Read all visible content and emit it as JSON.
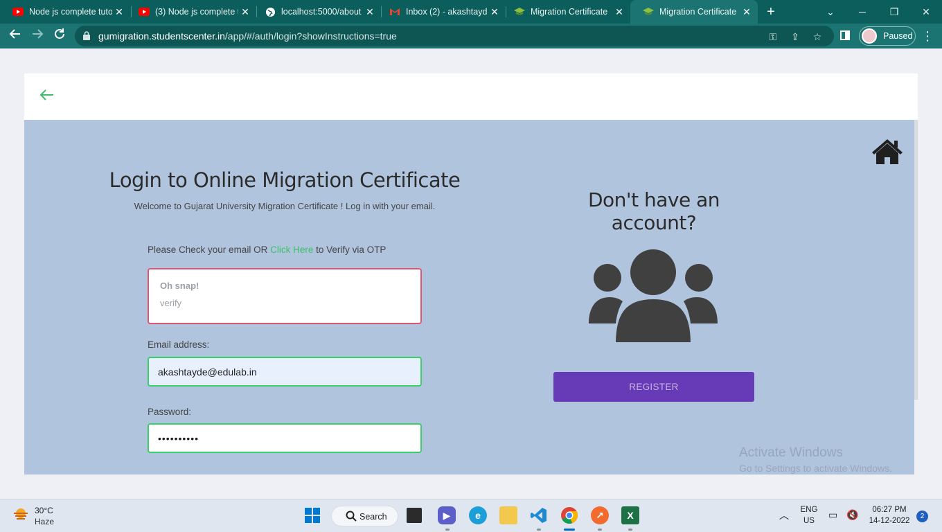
{
  "browser": {
    "tabs": [
      {
        "label": "Node js complete tuto",
        "icon": "youtube-icon"
      },
      {
        "label": "(3) Node js complete t",
        "icon": "youtube-icon"
      },
      {
        "label": "localhost:5000/about",
        "icon": "globe-icon"
      },
      {
        "label": "Inbox (2) - akashtayde",
        "icon": "gmail-icon"
      },
      {
        "label": "Migration Certificate",
        "icon": "graduation-cap-icon"
      },
      {
        "label": "Migration Certificate",
        "icon": "graduation-cap-icon"
      }
    ],
    "active_tab": 5,
    "url_host": "gumigration.studentscenter.in",
    "url_path": "/app/#/auth/login?showInstructions=true",
    "profile_label": "Paused"
  },
  "login": {
    "title": "Login to Online Migration Certificate",
    "subtitle": "Welcome to Gujarat University Migration Certificate ! Log in with your email.",
    "check_prefix": "Please Check your email OR ",
    "check_link": "Click Here",
    "check_suffix": " to Verify via OTP",
    "alert_title": "Oh snap!",
    "alert_message": "verify",
    "email_label": "Email address:",
    "email_value": "akashtayde@edulab.in",
    "password_label": "Password:",
    "password_value": "••••••••••"
  },
  "register": {
    "title": "Don't have an account?",
    "button_label": "REGISTER"
  },
  "watermark": {
    "line1": "Activate Windows",
    "line2": "Go to Settings to activate Windows."
  },
  "taskbar": {
    "temperature": "30°C",
    "weather": "Haze",
    "search_label": "Search",
    "lang": "ENG",
    "region": "US",
    "time": "06:27 PM",
    "date": "14-12-2022",
    "notifications": "2"
  },
  "colors": {
    "accent_green": "#3dbf6a",
    "register_purple": "#673ab7",
    "content_bg": "#b0c4de",
    "alert_border": "#e05570",
    "chrome_teal": "#0b5e5c"
  }
}
